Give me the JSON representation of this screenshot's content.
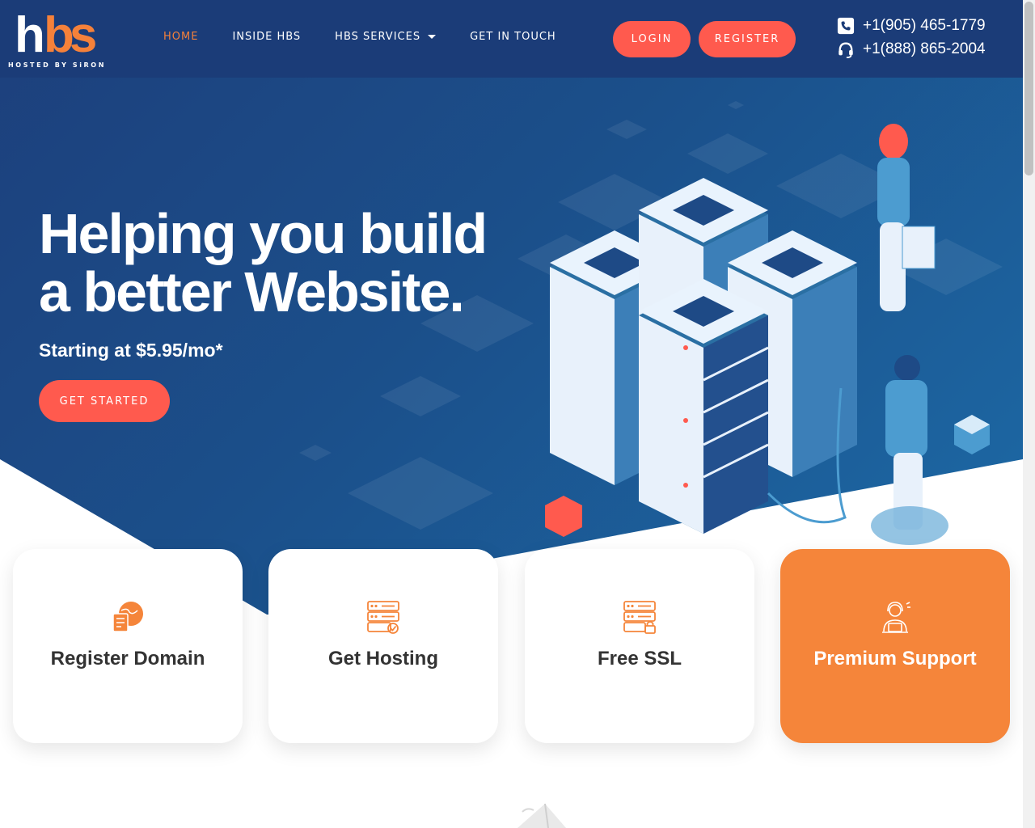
{
  "logo": {
    "tagline": "HOSTED BY SiRON"
  },
  "nav": {
    "items": [
      {
        "label": "HOME",
        "active": true
      },
      {
        "label": "INSIDE HBS",
        "active": false
      },
      {
        "label": "HBS SERVICES",
        "active": false,
        "dropdown": true
      },
      {
        "label": "GET IN TOUCH",
        "active": false
      }
    ],
    "login_label": "LOGIN",
    "register_label": "REGISTER",
    "phones": [
      "+1(905) 465-1779",
      "+1(888) 865-2004"
    ]
  },
  "hero": {
    "headline_line1": "Helping you build",
    "headline_line2": "a better Website.",
    "subline": "Starting at $5.95/mo*",
    "cta_label": "GET STARTED"
  },
  "cards": [
    {
      "title": "Register Domain",
      "icon": "domain-globe-icon",
      "highlighted": false
    },
    {
      "title": "Get Hosting",
      "icon": "server-check-icon",
      "highlighted": false
    },
    {
      "title": "Free SSL",
      "icon": "server-lock-icon",
      "highlighted": false
    },
    {
      "title": "Premium Support",
      "icon": "support-agent-icon",
      "highlighted": true
    }
  ],
  "colors": {
    "navy": "#1b3c78",
    "accent_orange": "#f5853a",
    "button_coral": "#ff5a4e"
  }
}
